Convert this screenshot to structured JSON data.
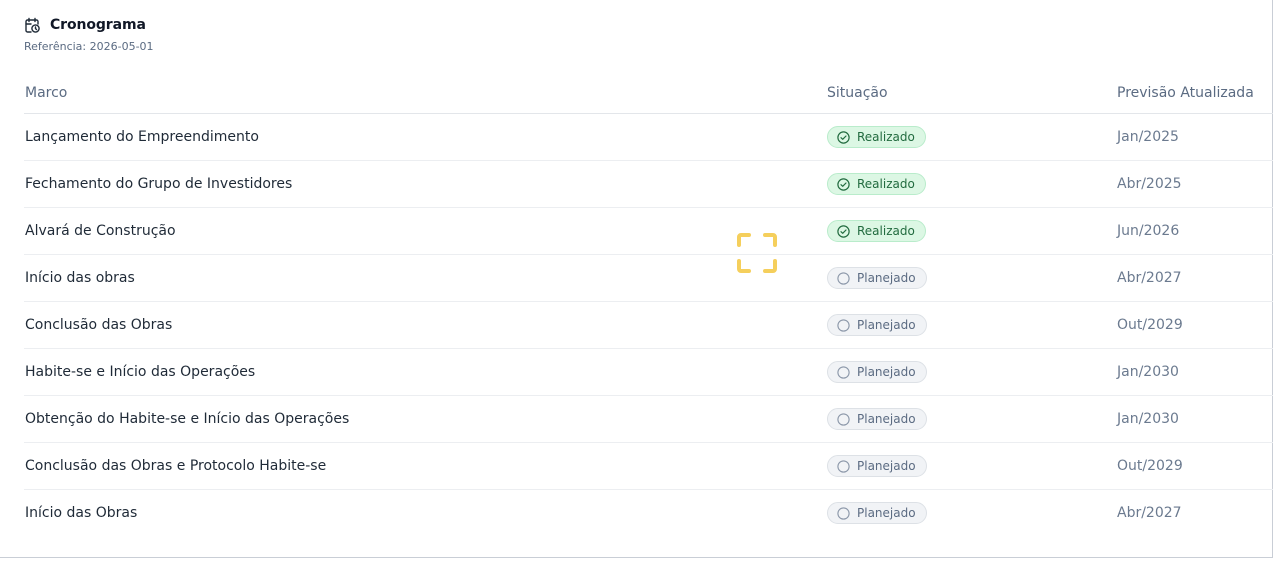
{
  "header": {
    "title": "Cronograma",
    "subtitle": "Referência: 2026-05-01",
    "icon": "calendar-clock-icon"
  },
  "table": {
    "columns": [
      "Marco",
      "Situação",
      "Previsão Atualizada"
    ],
    "rows": [
      {
        "marco": "Lançamento do Empreendimento",
        "situacao": "Realizado",
        "status": "done",
        "previsao": "Jan/2025"
      },
      {
        "marco": "Fechamento do Grupo de Investidores",
        "situacao": "Realizado",
        "status": "done",
        "previsao": "Abr/2025"
      },
      {
        "marco": "Alvará de Construção",
        "situacao": "Realizado",
        "status": "done",
        "previsao": "Jun/2026"
      },
      {
        "marco": "Início das obras",
        "situacao": "Planejado",
        "status": "plan",
        "previsao": "Abr/2027"
      },
      {
        "marco": "Conclusão das Obras",
        "situacao": "Planejado",
        "status": "plan",
        "previsao": "Out/2029"
      },
      {
        "marco": "Habite-se e Início das Operações",
        "situacao": "Planejado",
        "status": "plan",
        "previsao": "Jan/2030"
      },
      {
        "marco": "Obtenção do Habite-se e Início das Operações",
        "situacao": "Planejado",
        "status": "plan",
        "previsao": "Jan/2030"
      },
      {
        "marco": "Conclusão das Obras e Protocolo Habite-se",
        "situacao": "Planejado",
        "status": "plan",
        "previsao": "Out/2029"
      },
      {
        "marco": "Início das Obras",
        "situacao": "Planejado",
        "status": "plan",
        "previsao": "Abr/2027"
      }
    ]
  },
  "colors": {
    "done_bg": "#dcf7e4",
    "done_text": "#226b3f",
    "plan_bg": "#f1f3f6",
    "plan_text": "#5b6b82",
    "focus_marker": "#f5cf5c"
  },
  "icons": {
    "done": "check-circle-icon",
    "plan": "empty-circle-icon",
    "marker": "focus-frame-icon"
  }
}
